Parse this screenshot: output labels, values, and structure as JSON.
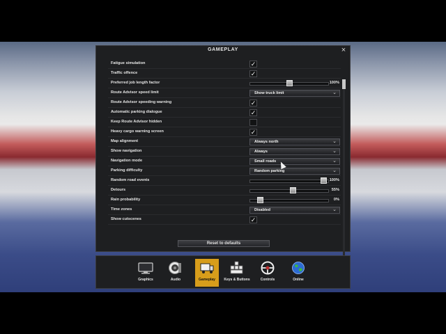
{
  "panel": {
    "title": "GAMEPLAY",
    "close_icon": "×"
  },
  "settings": [
    {
      "label": "Fatigue simulation",
      "control": "checkbox",
      "checked": true
    },
    {
      "label": "Traffic offence",
      "control": "checkbox",
      "checked": true
    },
    {
      "label": "Preferred job length factor",
      "control": "slider",
      "level": 0.5,
      "value": "100%"
    },
    {
      "label": "Route Advisor speed limit",
      "control": "dropdown",
      "value": "Show truck limit"
    },
    {
      "label": "Route Advisor speeding warning",
      "control": "checkbox",
      "checked": true
    },
    {
      "label": "Automatic parking dialogue",
      "control": "checkbox",
      "checked": true
    },
    {
      "label": "Keep Route Advisor hidden",
      "control": "checkbox",
      "checked": false
    },
    {
      "label": "Heavy cargo warning screen",
      "control": "checkbox",
      "checked": true
    },
    {
      "label": "Map alignment",
      "control": "dropdown",
      "value": "Always north"
    },
    {
      "label": "Show navigation",
      "control": "dropdown",
      "value": "Always"
    },
    {
      "label": "Navigation mode",
      "control": "dropdown",
      "value": "Small roads"
    },
    {
      "label": "Parking difficulty",
      "control": "dropdown",
      "value": "Random parking"
    },
    {
      "label": "Random road events",
      "control": "slider",
      "level": 0.97,
      "value": "100%"
    },
    {
      "label": "Detours",
      "control": "slider",
      "level": 0.55,
      "value": "55%"
    },
    {
      "label": "Rain probability",
      "control": "slider",
      "level": 0.1,
      "value": "0%"
    },
    {
      "label": "Time zones",
      "control": "dropdown",
      "value": "Disabled"
    },
    {
      "label": "Show cutscenes",
      "control": "checkbox",
      "checked": true
    }
  ],
  "check_glyph": "✓",
  "dropdown_arrow": "⌄",
  "reset_label": "Reset to defaults",
  "tabs": [
    {
      "label": "Graphics",
      "icon": "monitor-icon",
      "active": false
    },
    {
      "label": "Audio",
      "icon": "speaker-icon",
      "active": false
    },
    {
      "label": "Gameplay",
      "icon": "truck-icon",
      "active": true
    },
    {
      "label": "Keys & Buttons",
      "icon": "keyboard-icon",
      "active": false
    },
    {
      "label": "Controls",
      "icon": "steering-wheel-icon",
      "active": false
    },
    {
      "label": "Online",
      "icon": "globe-icon",
      "active": false
    }
  ],
  "colors": {
    "accent": "#d79d1b",
    "panel_bg": "#1e1f21"
  }
}
